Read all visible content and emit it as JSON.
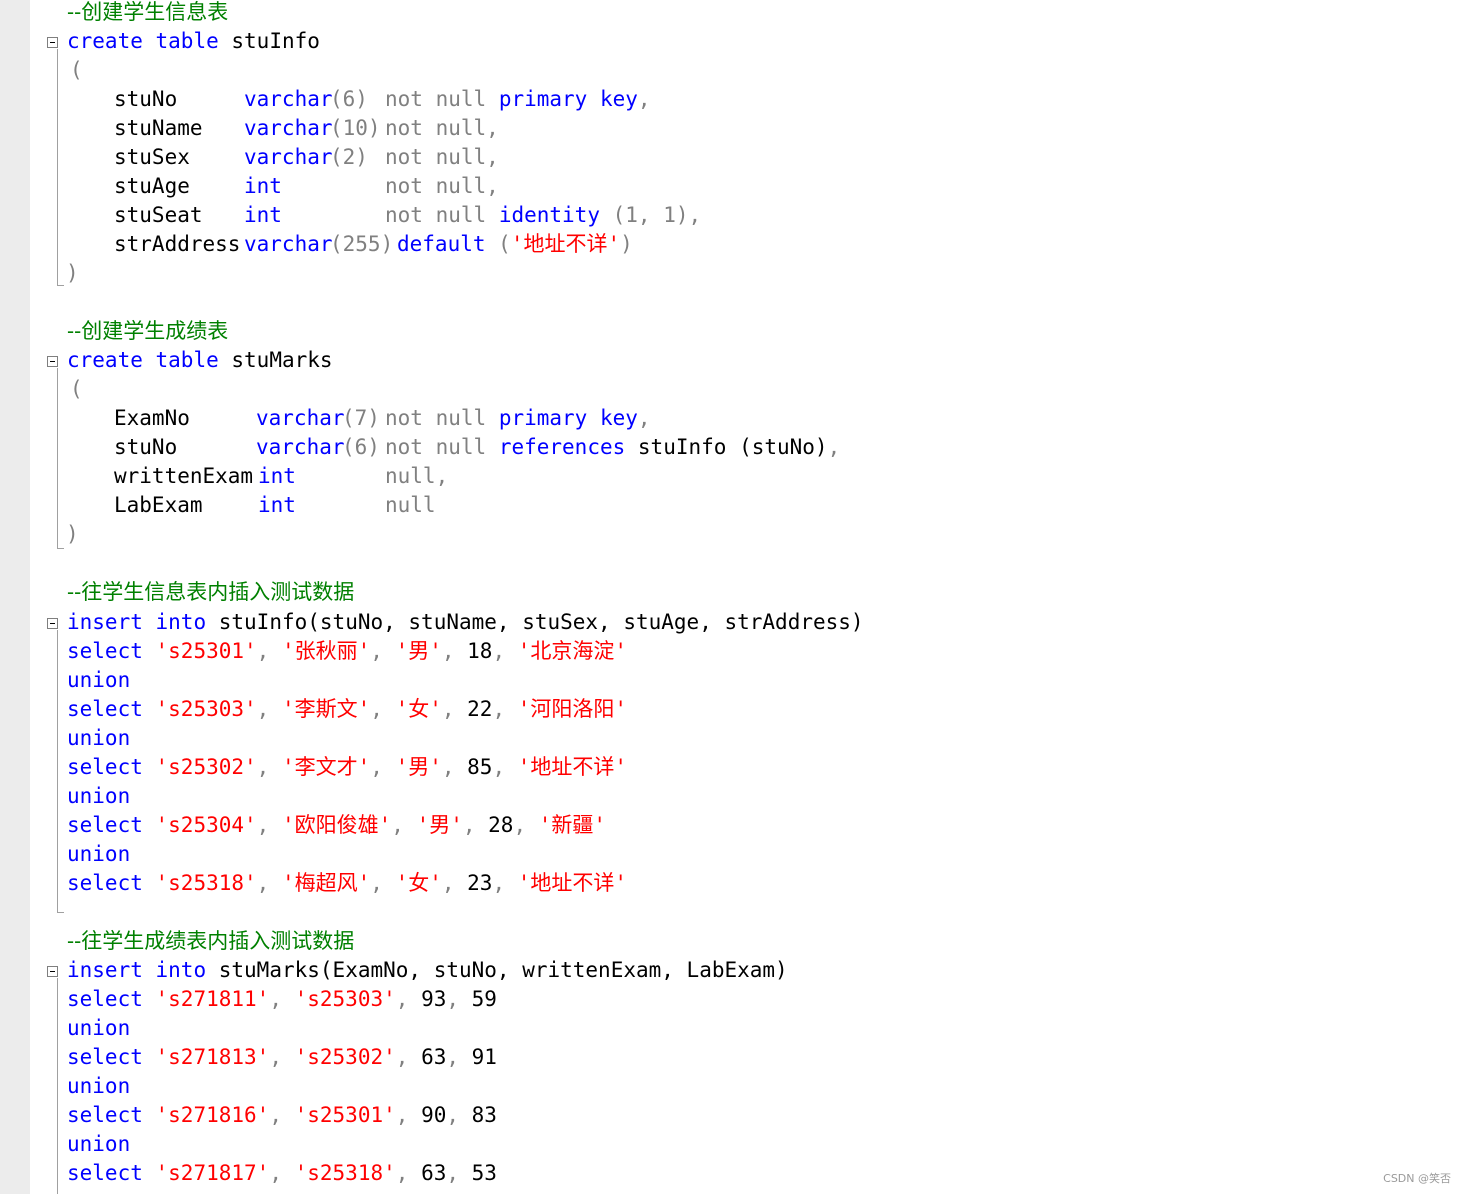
{
  "comments": {
    "c1": "--创建学生信息表",
    "c2": "--创建学生成绩表",
    "c3": "--往学生信息表内插入测试数据",
    "c4": "--往学生成绩表内插入测试数据"
  },
  "kw": {
    "create": "create",
    "table": "table",
    "varchar": "varchar",
    "int": "int",
    "not_null": "not null",
    "null": "null",
    "primary_key": "primary key",
    "identity": "identity",
    "default": "default",
    "references": "references",
    "insert": "insert",
    "into": "into",
    "select": "select",
    "union": "union"
  },
  "stuinfo": {
    "name": "stuInfo",
    "open": "(",
    "close": ")",
    "cols": {
      "c1": {
        "name": "stuNo",
        "size": "(6)"
      },
      "c2": {
        "name": "stuName",
        "size": "(10)"
      },
      "c3": {
        "name": "stuSex",
        "size": "(2)"
      },
      "c4": {
        "name": "stuAge"
      },
      "c5": {
        "name": "stuSeat",
        "args": "(1, 1)"
      },
      "c6": {
        "name": "strAddress",
        "size": "(255)",
        "default_val": "'地址不详'"
      }
    }
  },
  "stumarks": {
    "name": "stuMarks",
    "open": "(",
    "close": ")",
    "cols": {
      "c1": {
        "name": "ExamNo",
        "size": "(7)"
      },
      "c2": {
        "name": "stuNo",
        "size": "(6)",
        "ref_table": "stuInfo",
        "ref_col": "(stuNo)"
      },
      "c3": {
        "name": "writtenExam"
      },
      "c4": {
        "name": "LabExam"
      }
    }
  },
  "insert_info": {
    "table": "stuInfo",
    "cols": "(stuNo, stuName, stuSex, stuAge, strAddress)",
    "rows": {
      "r1": {
        "no": "'s25301'",
        "name": "'张秋丽'",
        "sex": "'男'",
        "age": "18",
        "addr": "'北京海淀'"
      },
      "r2": {
        "no": "'s25303'",
        "name": "'李斯文'",
        "sex": "'女'",
        "age": "22",
        "addr": "'河阳洛阳'"
      },
      "r3": {
        "no": "'s25302'",
        "name": "'李文才'",
        "sex": "'男'",
        "age": "85",
        "addr": "'地址不详'"
      },
      "r4": {
        "no": "'s25304'",
        "name": "'欧阳俊雄'",
        "sex": "'男'",
        "age": "28",
        "addr": "'新疆'"
      },
      "r5": {
        "no": "'s25318'",
        "name": "'梅超风'",
        "sex": "'女'",
        "age": "23",
        "addr": "'地址不详'"
      }
    }
  },
  "insert_marks": {
    "table": "stuMarks",
    "cols": "(ExamNo, stuNo, writtenExam, LabExam)",
    "rows": {
      "r1": {
        "exam": "'s271811'",
        "stu": "'s25303'",
        "w": "93",
        "l": "59"
      },
      "r2": {
        "exam": "'s271813'",
        "stu": "'s25302'",
        "w": "63",
        "l": "91"
      },
      "r3": {
        "exam": "'s271816'",
        "stu": "'s25301'",
        "w": "90",
        "l": "83"
      },
      "r4": {
        "exam": "'s271817'",
        "stu": "'s25318'",
        "w": "63",
        "l": "53"
      }
    }
  },
  "watermark": "CSDN @笑否"
}
